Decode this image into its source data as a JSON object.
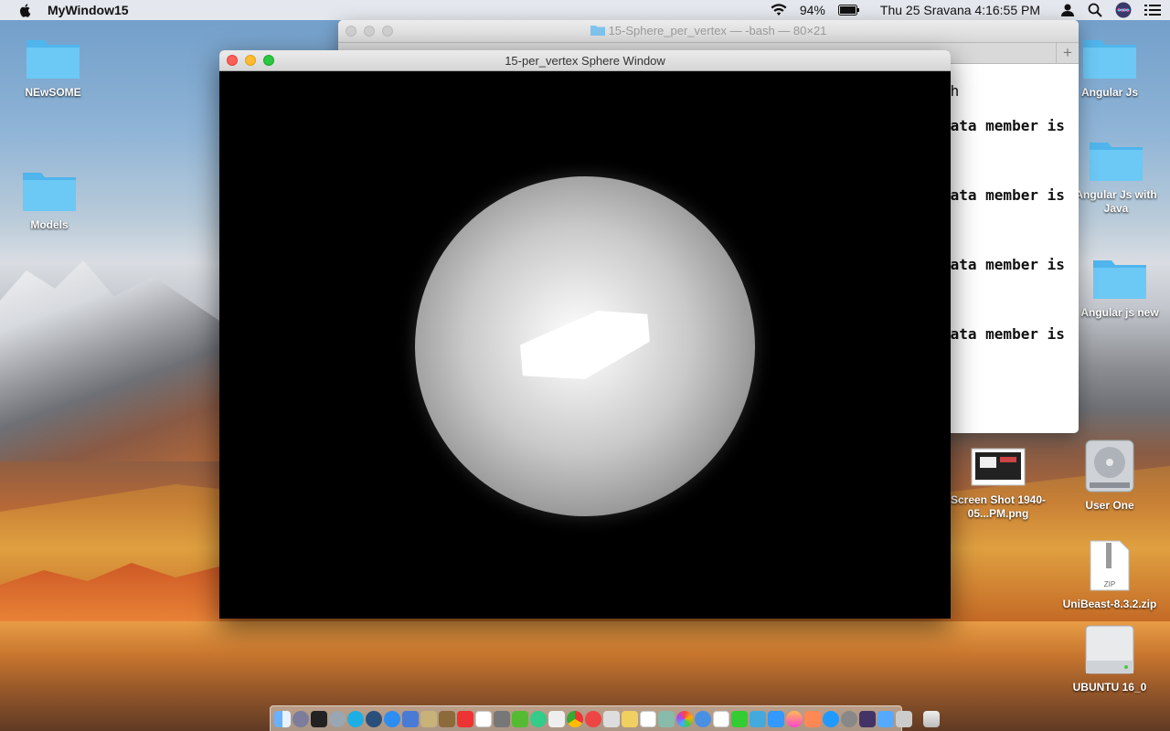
{
  "menubar": {
    "app_name": "MyWindow15",
    "battery": "94%",
    "clock": "Thu 25 Sravana  4:16:55 PM",
    "icons": [
      "apple-icon",
      "wifi-icon",
      "battery-icon",
      "user-icon",
      "search-icon",
      "siri-icon",
      "menu-list-icon"
    ]
  },
  "desktop_icons": {
    "newsome": "NEwSOME",
    "models": "Models",
    "angular_js": "Angular Js",
    "angular_js_java": "Angular Js with Java",
    "angular_js_new": "Angular js new",
    "screenshot": "Screen Shot 1940-05...PM.png",
    "user_one": "User One",
    "unibeast": "UniBeast-8.3.2.zip",
    "ubuntu": "UBUNTU 16_0"
  },
  "terminal": {
    "title": "15-Sphere_per_vertex — -bash — 80×21",
    "lines": [
      "sh",
      "data member is",
      "data member is",
      "data member is",
      "data member is"
    ]
  },
  "sphere_window": {
    "title": "15-per_vertex Sphere Window"
  },
  "dock": {
    "apps": [
      "finder",
      "launchpad",
      "terminal",
      "rocket",
      "skype",
      "quicktime",
      "safari",
      "preview",
      "notes",
      "calendar",
      "photos",
      "chrome",
      "trash"
    ]
  },
  "colors": {
    "close": "#fc5f57",
    "minimize": "#fdbc2e",
    "maximize": "#28c840",
    "folder": "#5ac8fa"
  }
}
